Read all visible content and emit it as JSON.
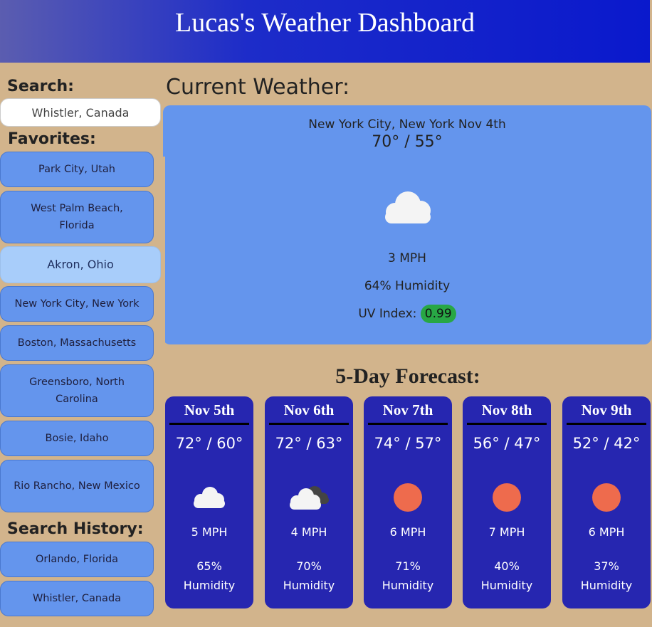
{
  "header": {
    "title": "Lucas's Weather Dashboard"
  },
  "sidebar": {
    "search_label": "Search:",
    "search_value": "Whistler, Canada",
    "favorites_label": "Favorites:",
    "favorites": [
      "Park City, Utah",
      "West Palm Beach, Florida",
      "Akron, Ohio",
      "New York City, New York",
      "Boston, Massachusetts",
      "Greensboro, North Carolina",
      "Bosie, Idaho",
      "Rio Rancho, New Mexico"
    ],
    "history_label": "Search History:",
    "history": [
      "Orlando, Florida",
      "Whistler, Canada"
    ]
  },
  "current": {
    "section_title": "Current Weather:",
    "location": "New York City, New York Nov 4th",
    "temp": "70° / 55°",
    "icon": "cloud-icon",
    "wind": "3 MPH",
    "humidity": "64% Humidity",
    "uv_label": "UV Index:",
    "uv_value": "0.99",
    "uv_color": "#28a745"
  },
  "forecast": {
    "title": "5-Day Forecast:",
    "days": [
      {
        "date": "Nov 5th",
        "temp": "72° / 60°",
        "icon": "cloud-icon",
        "wind": "5 MPH",
        "humidity_pct": "65%",
        "humidity_word": "Humidity"
      },
      {
        "date": "Nov 6th",
        "temp": "72° / 63°",
        "icon": "broken-clouds-icon",
        "wind": "4 MPH",
        "humidity_pct": "70%",
        "humidity_word": "Humidity"
      },
      {
        "date": "Nov 7th",
        "temp": "74° / 57°",
        "icon": "sun-icon",
        "wind": "6 MPH",
        "humidity_pct": "71%",
        "humidity_word": "Humidity"
      },
      {
        "date": "Nov 8th",
        "temp": "56° / 47°",
        "icon": "sun-icon",
        "wind": "7 MPH",
        "humidity_pct": "40%",
        "humidity_word": "Humidity"
      },
      {
        "date": "Nov 9th",
        "temp": "52° / 42°",
        "icon": "sun-icon",
        "wind": "6 MPH",
        "humidity_pct": "37%",
        "humidity_word": "Humidity"
      }
    ]
  },
  "colors": {
    "background": "#d2b48c",
    "card_blue": "#6495ed",
    "forecast_card": "#2626b0",
    "sun": "#ee6b4d",
    "active_favorite": "#a8cdfa"
  }
}
